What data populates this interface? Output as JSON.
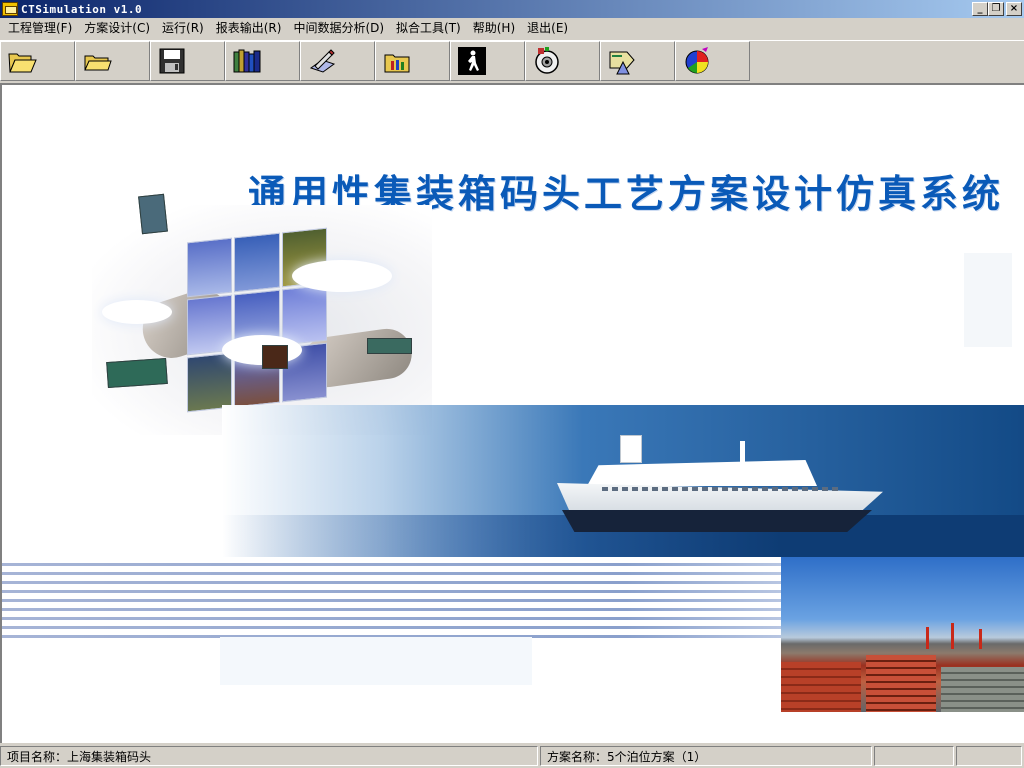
{
  "window": {
    "title": "CTSimulation v1.0",
    "controls": {
      "minimize": "_",
      "restore": "❐",
      "close": "×"
    }
  },
  "menu": {
    "items": [
      {
        "label": "工程管理(F)"
      },
      {
        "label": "方案设计(C)"
      },
      {
        "label": "运行(R)"
      },
      {
        "label": "报表输出(R)"
      },
      {
        "label": "中间数据分析(D)"
      },
      {
        "label": "拟合工具(T)"
      },
      {
        "label": "帮助(H)"
      },
      {
        "label": "退出(E)"
      }
    ]
  },
  "toolbar": {
    "buttons": [
      {
        "icon": "open-folder-icon"
      },
      {
        "icon": "folder-icon"
      },
      {
        "icon": "save-icon"
      },
      {
        "icon": "books-icon"
      },
      {
        "icon": "edit-document-icon"
      },
      {
        "icon": "tools-folder-icon"
      },
      {
        "icon": "run-person-icon"
      },
      {
        "icon": "media-reel-icon"
      },
      {
        "icon": "export-arrow-icon"
      },
      {
        "icon": "pie-chart-icon"
      }
    ]
  },
  "splash": {
    "title": "通用性集装箱码头工艺方案设计仿真系统",
    "title_color": "#0a5ab8"
  },
  "status": {
    "project": "项目名称：上海集装箱码头",
    "scheme": "方案名称：5个泊位方案（1）",
    "pane3": "",
    "pane4": ""
  },
  "colors": {
    "titlebar_start": "#0a246a",
    "titlebar_end": "#a6caf0",
    "face": "#d4d0c8"
  }
}
